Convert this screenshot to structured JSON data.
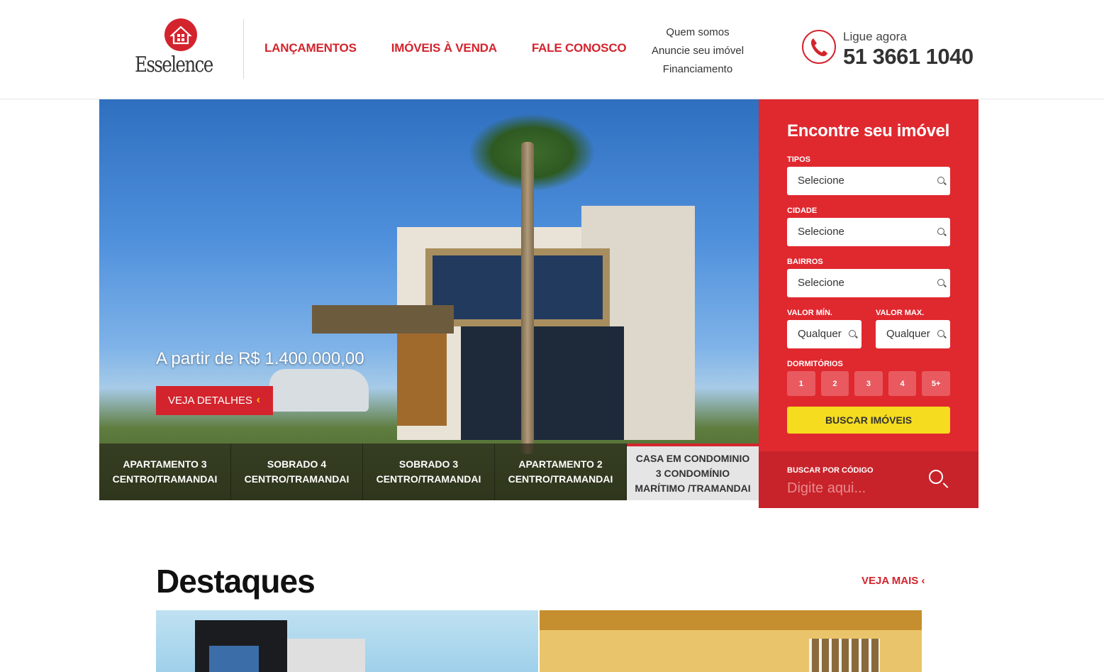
{
  "brand": {
    "name": "Esselence"
  },
  "nav": {
    "main": [
      "LANÇAMENTOS",
      "IMÓVEIS À VENDA",
      "FALE CONOSCO"
    ],
    "secondary": [
      "Quem somos",
      "Anuncie seu imóvel",
      "Financiamento"
    ]
  },
  "contact": {
    "label": "Ligue agora",
    "phone": "51 3661 1040"
  },
  "hero": {
    "price": "A partir de R$ 1.400.000,00",
    "button": "VEJA DETALHES",
    "tabs": [
      "APARTAMENTO 3 CENTRO/TRAMANDAI",
      "SOBRADO 4 CENTRO/TRAMANDAI",
      "SOBRADO 3 CENTRO/TRAMANDAI",
      "APARTAMENTO 2 CENTRO/TRAMANDAI",
      "CASA EM CONDOMINIO 3 CONDOMÍNIO MARÍTIMO /TRAMANDAI"
    ],
    "active_tab": 4
  },
  "search": {
    "title": "Encontre seu imóvel",
    "tipos": {
      "label": "TIPOS",
      "value": "Selecione"
    },
    "cidade": {
      "label": "CIDADE",
      "value": "Selecione"
    },
    "bairros": {
      "label": "BAIRROS",
      "value": "Selecione"
    },
    "valor_min": {
      "label": "VALOR MÍN.",
      "value": "Qualquer"
    },
    "valor_max": {
      "label": "VALOR MAX.",
      "value": "Qualquer"
    },
    "dormitorios": {
      "label": "DORMITÓRIOS",
      "options": [
        "1",
        "2",
        "3",
        "4",
        "5+"
      ]
    },
    "submit": "BUSCAR IMÓVEIS",
    "codigo": {
      "label": "BUSCAR POR CÓDIGO",
      "placeholder": "Digite aqui..."
    }
  },
  "destaques": {
    "title": "Destaques",
    "more": "VEJA MAIS"
  },
  "colors": {
    "accent": "#d3242d",
    "panel": "#e0282f",
    "button_yellow": "#f5dc1e"
  },
  "icons": [
    "house-logo-icon",
    "phone-icon",
    "search-icon",
    "chevron-left-icon"
  ]
}
